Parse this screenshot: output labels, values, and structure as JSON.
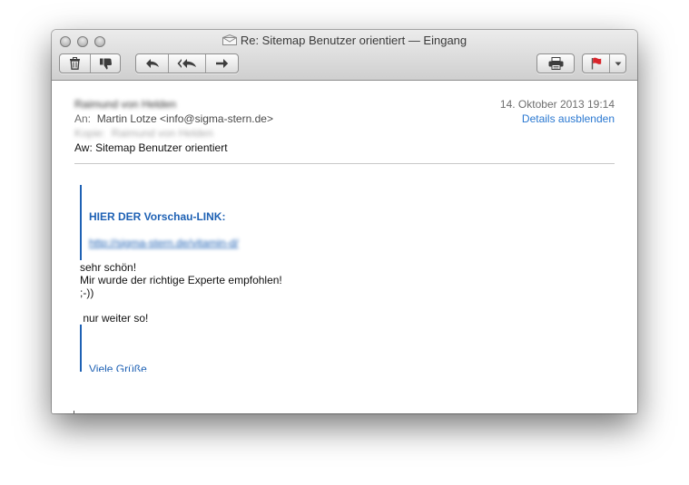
{
  "window": {
    "title": "Re: Sitemap Benutzer orientiert — Eingang"
  },
  "toolbar": {
    "buttons": [
      "delete",
      "junk",
      "reply",
      "reply-all",
      "forward",
      "print",
      "flag"
    ],
    "flag_color": "#d9252b"
  },
  "message": {
    "from": "Raimund von Helden",
    "to_label": "An:",
    "to_value": "Martin Lotze <info@sigma-stern.de>",
    "cc_label": "Kopie:",
    "cc_value": "Raimund von Helden",
    "subject": "Aw: Sitemap Benutzer orientiert",
    "date": "14. Oktober 2013 19:14",
    "details_link": "Details ausblenden"
  },
  "body": {
    "quote_heading": "HIER DER Vorschau-LINK:",
    "quote_link": "http://sigma-stern.de/vitamin-d/",
    "lines": [
      "sehr schön!",
      "Mir wurde der richtige Experte empfohlen!",
      ";-))",
      "",
      " nur weiter so!"
    ],
    "greeting": "Viele Grüße"
  },
  "colors": {
    "link_blue": "#2a78d1",
    "quote_blue": "#1e61b4"
  }
}
